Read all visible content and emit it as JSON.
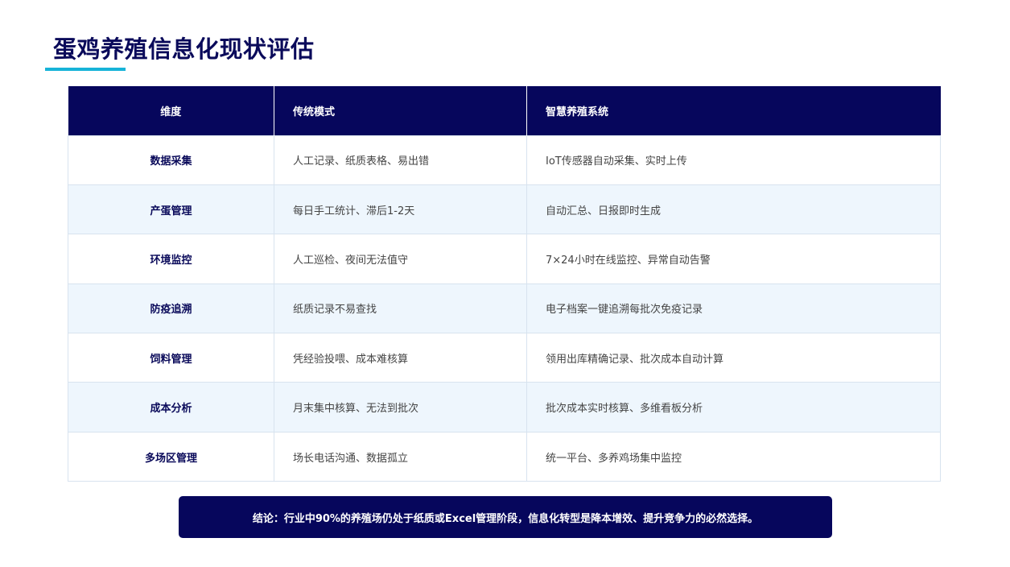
{
  "title": "蛋鸡养殖信息化现状评估",
  "table": {
    "headers": [
      "维度",
      "传统模式",
      "智慧养殖系统"
    ],
    "rows": [
      {
        "dimension": "数据采集",
        "traditional": "人工记录、纸质表格、易出错",
        "smart": "IoT传感器自动采集、实时上传"
      },
      {
        "dimension": "产蛋管理",
        "traditional": "每日手工统计、滞后1-2天",
        "smart": "自动汇总、日报即时生成"
      },
      {
        "dimension": "环境监控",
        "traditional": "人工巡检、夜间无法值守",
        "smart": "7×24小时在线监控、异常自动告警"
      },
      {
        "dimension": "防疫追溯",
        "traditional": "纸质记录不易查找",
        "smart": "电子档案一键追溯每批次免疫记录"
      },
      {
        "dimension": "饲料管理",
        "traditional": "凭经验投喂、成本难核算",
        "smart": "领用出库精确记录、批次成本自动计算"
      },
      {
        "dimension": "成本分析",
        "traditional": "月末集中核算、无法到批次",
        "smart": "批次成本实时核算、多维看板分析"
      },
      {
        "dimension": "多场区管理",
        "traditional": "场长电话沟通、数据孤立",
        "smart": "统一平台、多养鸡场集中监控"
      }
    ]
  },
  "conclusion": "结论：行业中90%的养殖场仍处于纸质或Excel管理阶段，信息化转型是降本增效、提升竞争力的必然选择。",
  "colors": {
    "primary": "#06065c",
    "accent": "#17b3d8",
    "row_alt": "#eef6fd"
  }
}
